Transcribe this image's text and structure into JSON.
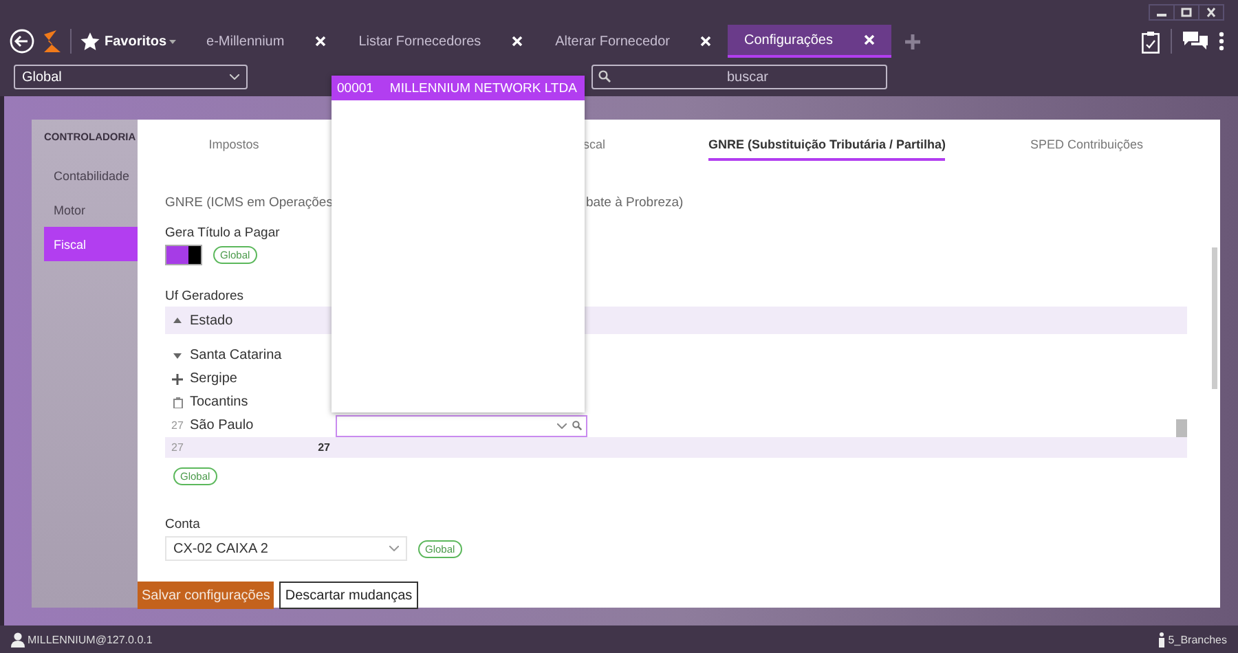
{
  "header": {
    "favorites": "Favoritos",
    "tabs": [
      {
        "label": "e-Millennium",
        "selected": false
      },
      {
        "label": "Listar Fornecedores",
        "selected": false
      },
      {
        "label": "Alterar Fornecedor",
        "selected": false
      },
      {
        "label": "Configurações",
        "selected": true
      }
    ]
  },
  "toolbar": {
    "scope": "Global",
    "search": {
      "placeholder": "buscar"
    }
  },
  "sidebar": {
    "section": "CONTROLADORIA",
    "items": [
      {
        "label": "Contabilidade",
        "selected": false
      },
      {
        "label": "Motor",
        "selected": false
      },
      {
        "label": "Fiscal",
        "selected": true
      }
    ]
  },
  "content_tabs": [
    {
      "label": "Impostos",
      "selected": false
    },
    {
      "label": "scal",
      "selected": false
    },
    {
      "label": "GNRE (Substituição Tributária / Partilha)",
      "selected": true
    },
    {
      "label": "SPED Contribuições",
      "selected": false
    }
  ],
  "section_title": [
    "GNRE (ICMS em Operações",
    "bate à Probreza)"
  ],
  "gera_titulo": {
    "label": "Gera Título a Pagar",
    "on": true,
    "badge": "Global"
  },
  "uf_grid": {
    "label": "Uf Geradores",
    "column": "Estado",
    "rows": [
      {
        "estado": "Santa Catarina",
        "editing": false
      },
      {
        "estado": "Sergipe",
        "editing": false
      },
      {
        "estado": "Tocantins",
        "editing": false
      },
      {
        "estado": "São Paulo",
        "editing": true,
        "row_number": "27"
      }
    ],
    "footer": {
      "count": "27",
      "total": "27"
    },
    "badge": "Global"
  },
  "conta": {
    "label": "Conta",
    "value": "CX-02 CAIXA 2",
    "badge": "Global"
  },
  "buttons": [
    {
      "label": "Salvar configurações",
      "kind": "primary"
    },
    {
      "label": "Descartar mudanças",
      "kind": "secondary"
    }
  ],
  "dropdown": {
    "items": [
      {
        "code": "00001",
        "name": "MILLENNIUM NETWORK LTDA",
        "selected": true
      }
    ]
  },
  "status_bar": {
    "user": "MILLENNIUM@127.0.0.1",
    "branches": "5_Branches"
  }
}
